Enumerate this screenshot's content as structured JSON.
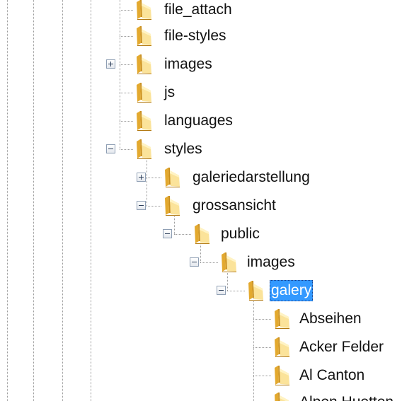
{
  "tree": {
    "nodes": [
      {
        "label": "file_attach",
        "state": "leaf",
        "selected": false
      },
      {
        "label": "file-styles",
        "state": "leaf",
        "selected": false
      },
      {
        "label": "images",
        "state": "collapsed",
        "selected": false
      },
      {
        "label": "js",
        "state": "leaf",
        "selected": false
      },
      {
        "label": "languages",
        "state": "leaf",
        "selected": false
      },
      {
        "label": "styles",
        "state": "expanded",
        "selected": false
      },
      {
        "label": "galeriedarstellung",
        "state": "collapsed",
        "selected": false
      },
      {
        "label": "grossansicht",
        "state": "expanded",
        "selected": false
      },
      {
        "label": "public",
        "state": "expanded",
        "selected": false
      },
      {
        "label": "images",
        "state": "expanded",
        "selected": false
      },
      {
        "label": "galery",
        "state": "expanded",
        "selected": true
      },
      {
        "label": "Abseihen",
        "state": "leaf",
        "selected": false
      },
      {
        "label": "Acker Felder",
        "state": "leaf",
        "selected": false
      },
      {
        "label": "Al Canton",
        "state": "leaf",
        "selected": false
      },
      {
        "label": "Alpen Huetten",
        "state": "leaf",
        "selected": false
      }
    ]
  },
  "colors": {
    "selection": "#3399ff",
    "folder_light": "#fbe39a",
    "folder_dark": "#e3a92f",
    "tree_line": "#9a9a9a"
  },
  "icons": {
    "folder": "folder-icon",
    "expand": "plus-box-icon",
    "collapse": "minus-box-icon"
  }
}
